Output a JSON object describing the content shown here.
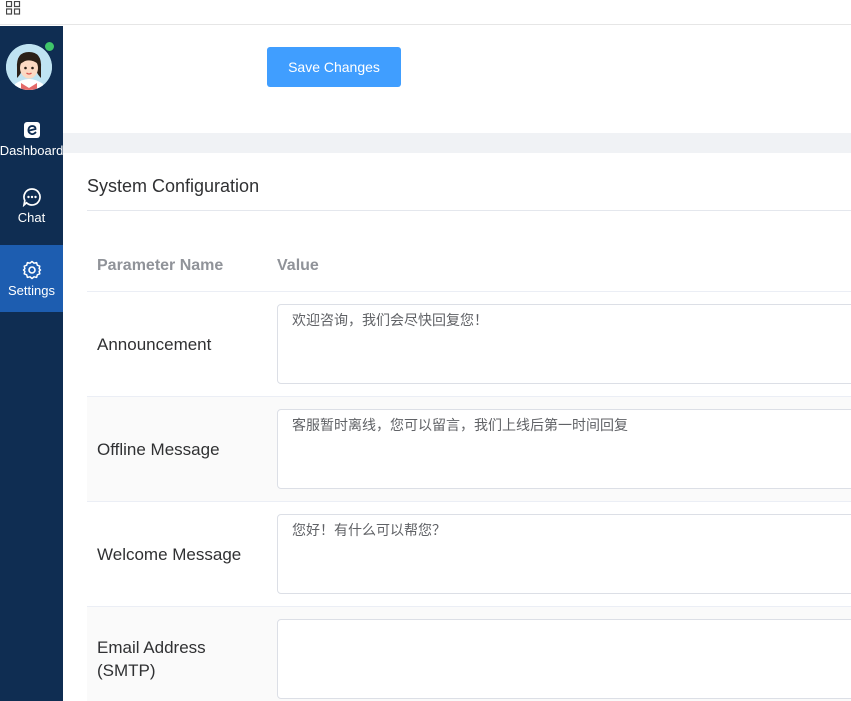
{
  "sidebar": {
    "nav": [
      {
        "label": "Dashboard",
        "icon": "dashboard-icon"
      },
      {
        "label": "Chat",
        "icon": "chat-icon"
      },
      {
        "label": "Settings",
        "icon": "gear-icon",
        "active": true
      }
    ],
    "online_color": "#3fc56a"
  },
  "toolbar": {
    "save_label": "Save Changes"
  },
  "config": {
    "title": "System Configuration",
    "columns": {
      "name": "Parameter Name",
      "value": "Value"
    },
    "rows": [
      {
        "label": "Announcement",
        "value": "欢迎咨询，我们会尽快回复您！"
      },
      {
        "label": "Offline Message",
        "value": "客服暂时离线，您可以留言，我们上线后第一时间回复"
      },
      {
        "label": "Welcome Message",
        "value": "您好！有什么可以帮您？"
      },
      {
        "label": "Email Address (SMTP)",
        "value": ""
      }
    ]
  },
  "colors": {
    "sidebar_bg": "#0f2d52",
    "active_nav": "#1d5db0",
    "primary": "#409eff"
  }
}
